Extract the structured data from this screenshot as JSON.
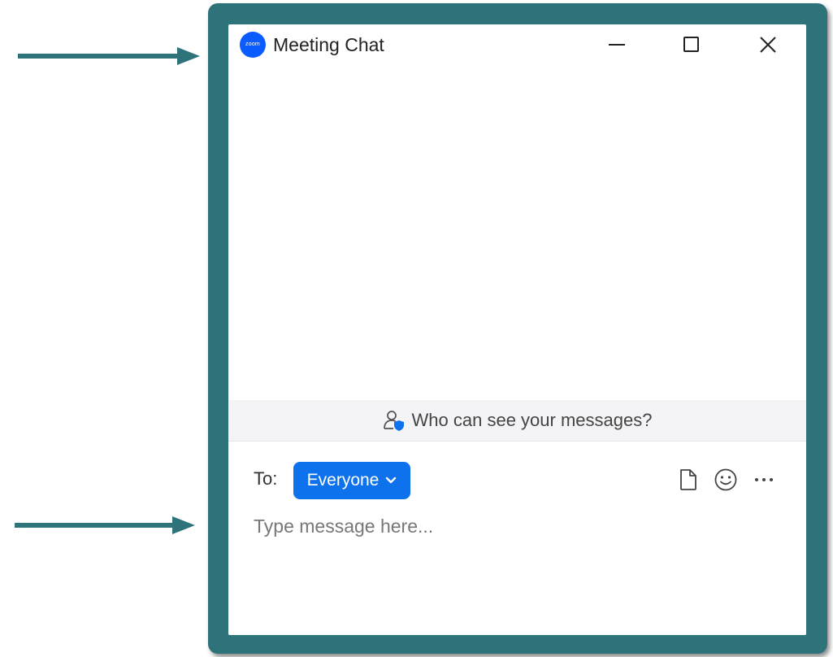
{
  "window": {
    "title": "Meeting Chat",
    "logo_text": "zoom"
  },
  "chat": {
    "visibility_prompt": "Who can see your messages?",
    "to_label": "To:",
    "recipient": "Everyone",
    "input_placeholder": "Type message here..."
  },
  "icons": {
    "minimize": "minimize-icon",
    "maximize": "maximize-icon",
    "close": "close-icon",
    "visibility": "user-shield-icon",
    "recipient_chevron": "chevron-down-icon",
    "file": "file-icon",
    "emoji": "emoji-icon",
    "more": "more-horizontal-icon"
  },
  "colors": {
    "frame": "#2e737a",
    "accent": "#0e72ed",
    "logo": "#0b5cff",
    "visibility_bar": "#f4f4f7"
  }
}
